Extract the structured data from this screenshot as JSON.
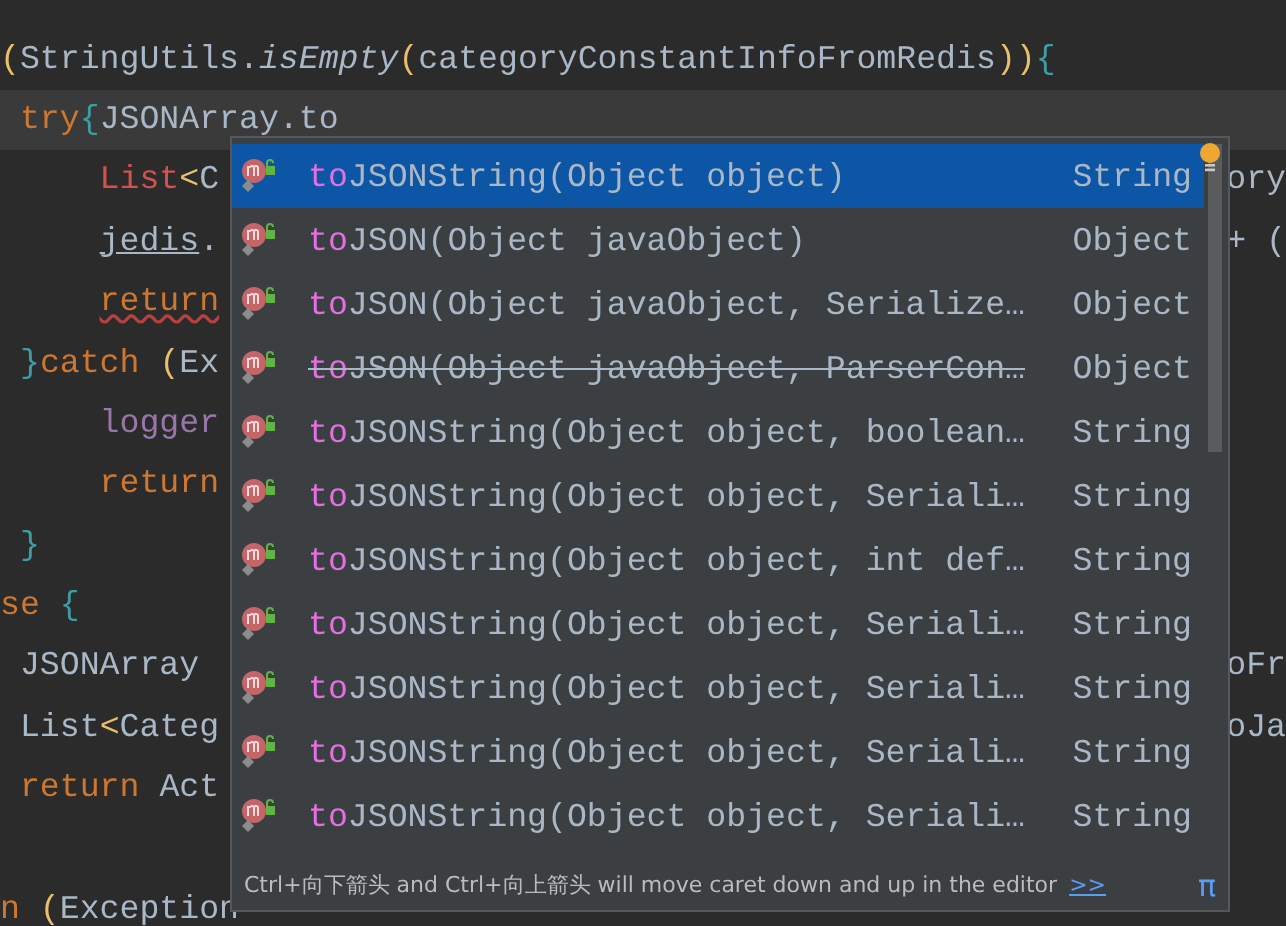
{
  "editor": {
    "lines": [
      {
        "kind": "blank"
      },
      {
        "kind": "code",
        "current": false,
        "tokens": [
          {
            "text": "(",
            "kind": "paren"
          },
          {
            "text": "StringUtils.",
            "kind": "plain"
          },
          {
            "text": "isEmpty",
            "kind": "static"
          },
          {
            "text": "(",
            "kind": "paren"
          },
          {
            "text": "categoryConstantInfoFromRedis",
            "kind": "plain"
          },
          {
            "text": "))",
            "kind": "paren"
          },
          {
            "text": "{",
            "kind": "brace"
          }
        ]
      },
      {
        "kind": "code",
        "current": true,
        "tokens": [
          {
            "text": " try",
            "kind": "keyword"
          },
          {
            "text": "{",
            "kind": "brace"
          },
          {
            "text": "JSONArray.to",
            "kind": "plain"
          }
        ]
      },
      {
        "kind": "code",
        "current": false,
        "tokens": [
          {
            "text": "     List",
            "kind": "error"
          },
          {
            "text": "<",
            "kind": "paren"
          },
          {
            "text": "C",
            "kind": "plain"
          }
        ],
        "tail": "ory"
      },
      {
        "kind": "code",
        "current": false,
        "tokens": [
          {
            "text": "     jedis",
            "kind": "ref"
          },
          {
            "text": ".",
            "kind": "plain"
          }
        ],
        "tail": "+ ("
      },
      {
        "kind": "code",
        "current": false,
        "tokens": [
          {
            "text": "     return",
            "kind": "warn"
          }
        ]
      },
      {
        "kind": "code",
        "current": false,
        "tokens": [
          {
            "text": " }",
            "kind": "brace"
          },
          {
            "text": "catch ",
            "kind": "keyword"
          },
          {
            "text": "(",
            "kind": "paren"
          },
          {
            "text": "Ex",
            "kind": "plain"
          }
        ]
      },
      {
        "kind": "code",
        "current": false,
        "tokens": [
          {
            "text": "     logger",
            "kind": "field"
          }
        ]
      },
      {
        "kind": "code",
        "current": false,
        "tokens": [
          {
            "text": "     return",
            "kind": "keyword"
          }
        ]
      },
      {
        "kind": "code",
        "current": false,
        "tokens": [
          {
            "text": " }",
            "kind": "brace"
          }
        ]
      },
      {
        "kind": "code",
        "current": false,
        "tokens": [
          {
            "text": "se",
            "kind": "keyword"
          },
          {
            "text": " {",
            "kind": "brace"
          }
        ]
      },
      {
        "kind": "code",
        "current": false,
        "tokens": [
          {
            "text": " JSONArray",
            "kind": "plain"
          }
        ],
        "tail": "oFr"
      },
      {
        "kind": "code",
        "current": false,
        "tokens": [
          {
            "text": " List",
            "kind": "plain"
          },
          {
            "text": "<",
            "kind": "paren"
          },
          {
            "text": "Categ",
            "kind": "plain"
          }
        ],
        "tail": "oJa"
      },
      {
        "kind": "code",
        "current": false,
        "tokens": [
          {
            "text": " return",
            "kind": "keyword"
          },
          {
            "text": " Act",
            "kind": "plain"
          }
        ]
      },
      {
        "kind": "blank"
      },
      {
        "kind": "code",
        "current": false,
        "tokens": [
          {
            "text": "n ",
            "kind": "keyword"
          },
          {
            "text": "(",
            "kind": "paren"
          },
          {
            "text": "Exception",
            "kind": "plain"
          }
        ]
      }
    ]
  },
  "completion": {
    "items": [
      {
        "match": "to",
        "rest": "JSONString(Object object)",
        "type": "String",
        "selected": true,
        "deprecated": false
      },
      {
        "match": "to",
        "rest": "JSON(Object javaObject)",
        "type": "Object",
        "selected": false,
        "deprecated": false
      },
      {
        "match": "to",
        "rest": "JSON(Object javaObject, Serialize…",
        "type": "Object",
        "selected": false,
        "deprecated": false
      },
      {
        "match": "to",
        "rest": "JSON(Object javaObject, ParserCon…",
        "type": "Object",
        "selected": false,
        "deprecated": true
      },
      {
        "match": "to",
        "rest": "JSONString(Object object, boolean…",
        "type": "String",
        "selected": false,
        "deprecated": false
      },
      {
        "match": "to",
        "rest": "JSONString(Object object, Seriali…",
        "type": "String",
        "selected": false,
        "deprecated": false
      },
      {
        "match": "to",
        "rest": "JSONString(Object object, int def…",
        "type": "String",
        "selected": false,
        "deprecated": false
      },
      {
        "match": "to",
        "rest": "JSONString(Object object, Seriali…",
        "type": "String",
        "selected": false,
        "deprecated": false
      },
      {
        "match": "to",
        "rest": "JSONString(Object object, Seriali…",
        "type": "String",
        "selected": false,
        "deprecated": false
      },
      {
        "match": "to",
        "rest": "JSONString(Object object, Seriali…",
        "type": "String",
        "selected": false,
        "deprecated": false
      },
      {
        "match": "to",
        "rest": "JSONString(Object object, Seriali…",
        "type": "String",
        "selected": false,
        "deprecated": false
      }
    ],
    "hint": "Ctrl+向下箭头 and Ctrl+向上箭头 will move caret down and up in the editor",
    "hint_link": ">>",
    "pi": "π"
  }
}
